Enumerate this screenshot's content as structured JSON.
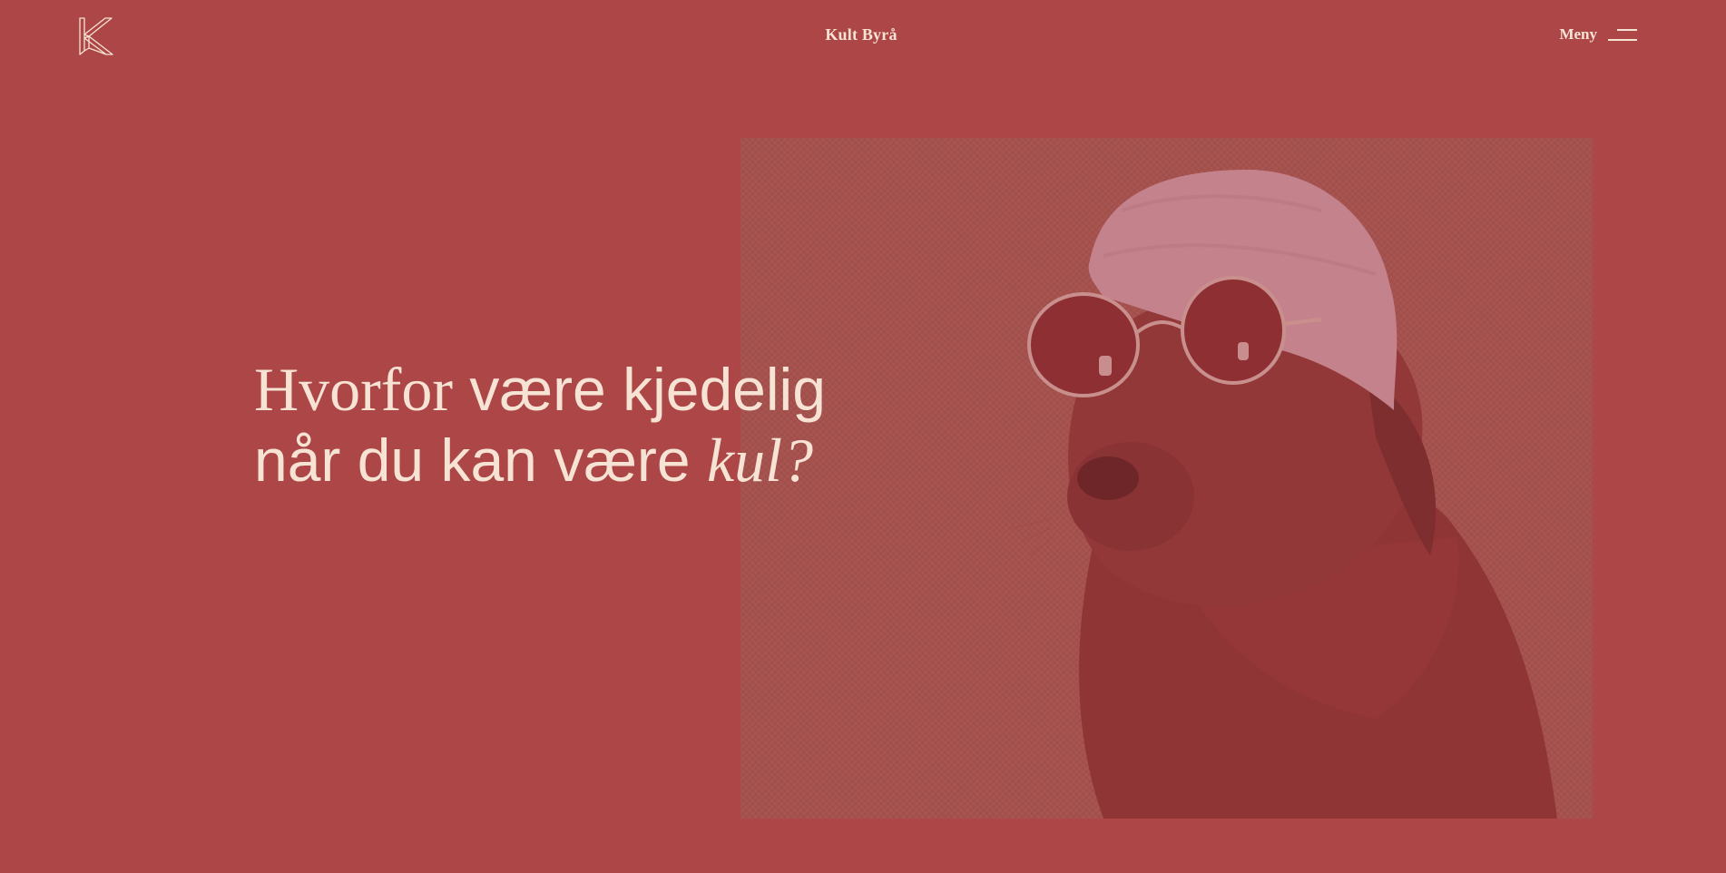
{
  "header": {
    "logo_name": "kult-logo-k",
    "site_title": "Kult Byrå",
    "menu_label": "Meny",
    "menu_icon": "hamburger-icon"
  },
  "hero": {
    "headline": {
      "line1_serif": "Hvorfor",
      "line1_sans": " være kjedelig",
      "line2_sans": "når du kan være ",
      "line2_italic": "kul?"
    },
    "image": {
      "subject": "dog-with-beanie-and-sunglasses"
    }
  },
  "colors": {
    "background": "#ad4747",
    "text": "#f6e3d4",
    "image_tint": "#a95450"
  }
}
